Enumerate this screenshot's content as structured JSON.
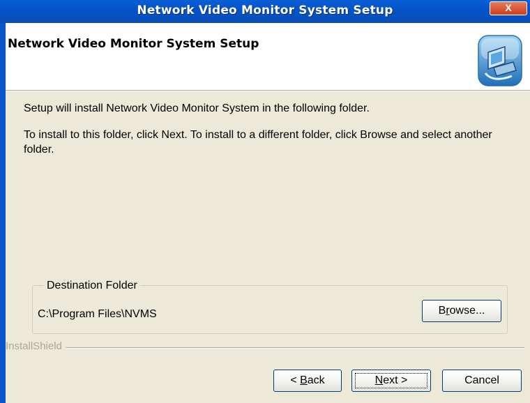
{
  "window": {
    "title": "Network Video Monitor System Setup",
    "close_glyph": "X"
  },
  "header": {
    "title": "Network Video Monitor System Setup",
    "icon": "setup-computer-icon"
  },
  "body": {
    "line1": "Setup will install Network Video Monitor System in the following folder.",
    "line2": "To install to this folder, click Next. To install to a different folder, click Browse and select another folder."
  },
  "destination": {
    "legend": "Destination Folder",
    "path": "C:\\Program Files\\NVMS",
    "browse_pre": "B",
    "browse_key": "r",
    "browse_post": "owse..."
  },
  "footer": {
    "brand": "InstallShield",
    "back_pre": "< ",
    "back_key": "B",
    "back_post": "ack",
    "next_key": "N",
    "next_post": "ext >",
    "cancel": "Cancel"
  }
}
